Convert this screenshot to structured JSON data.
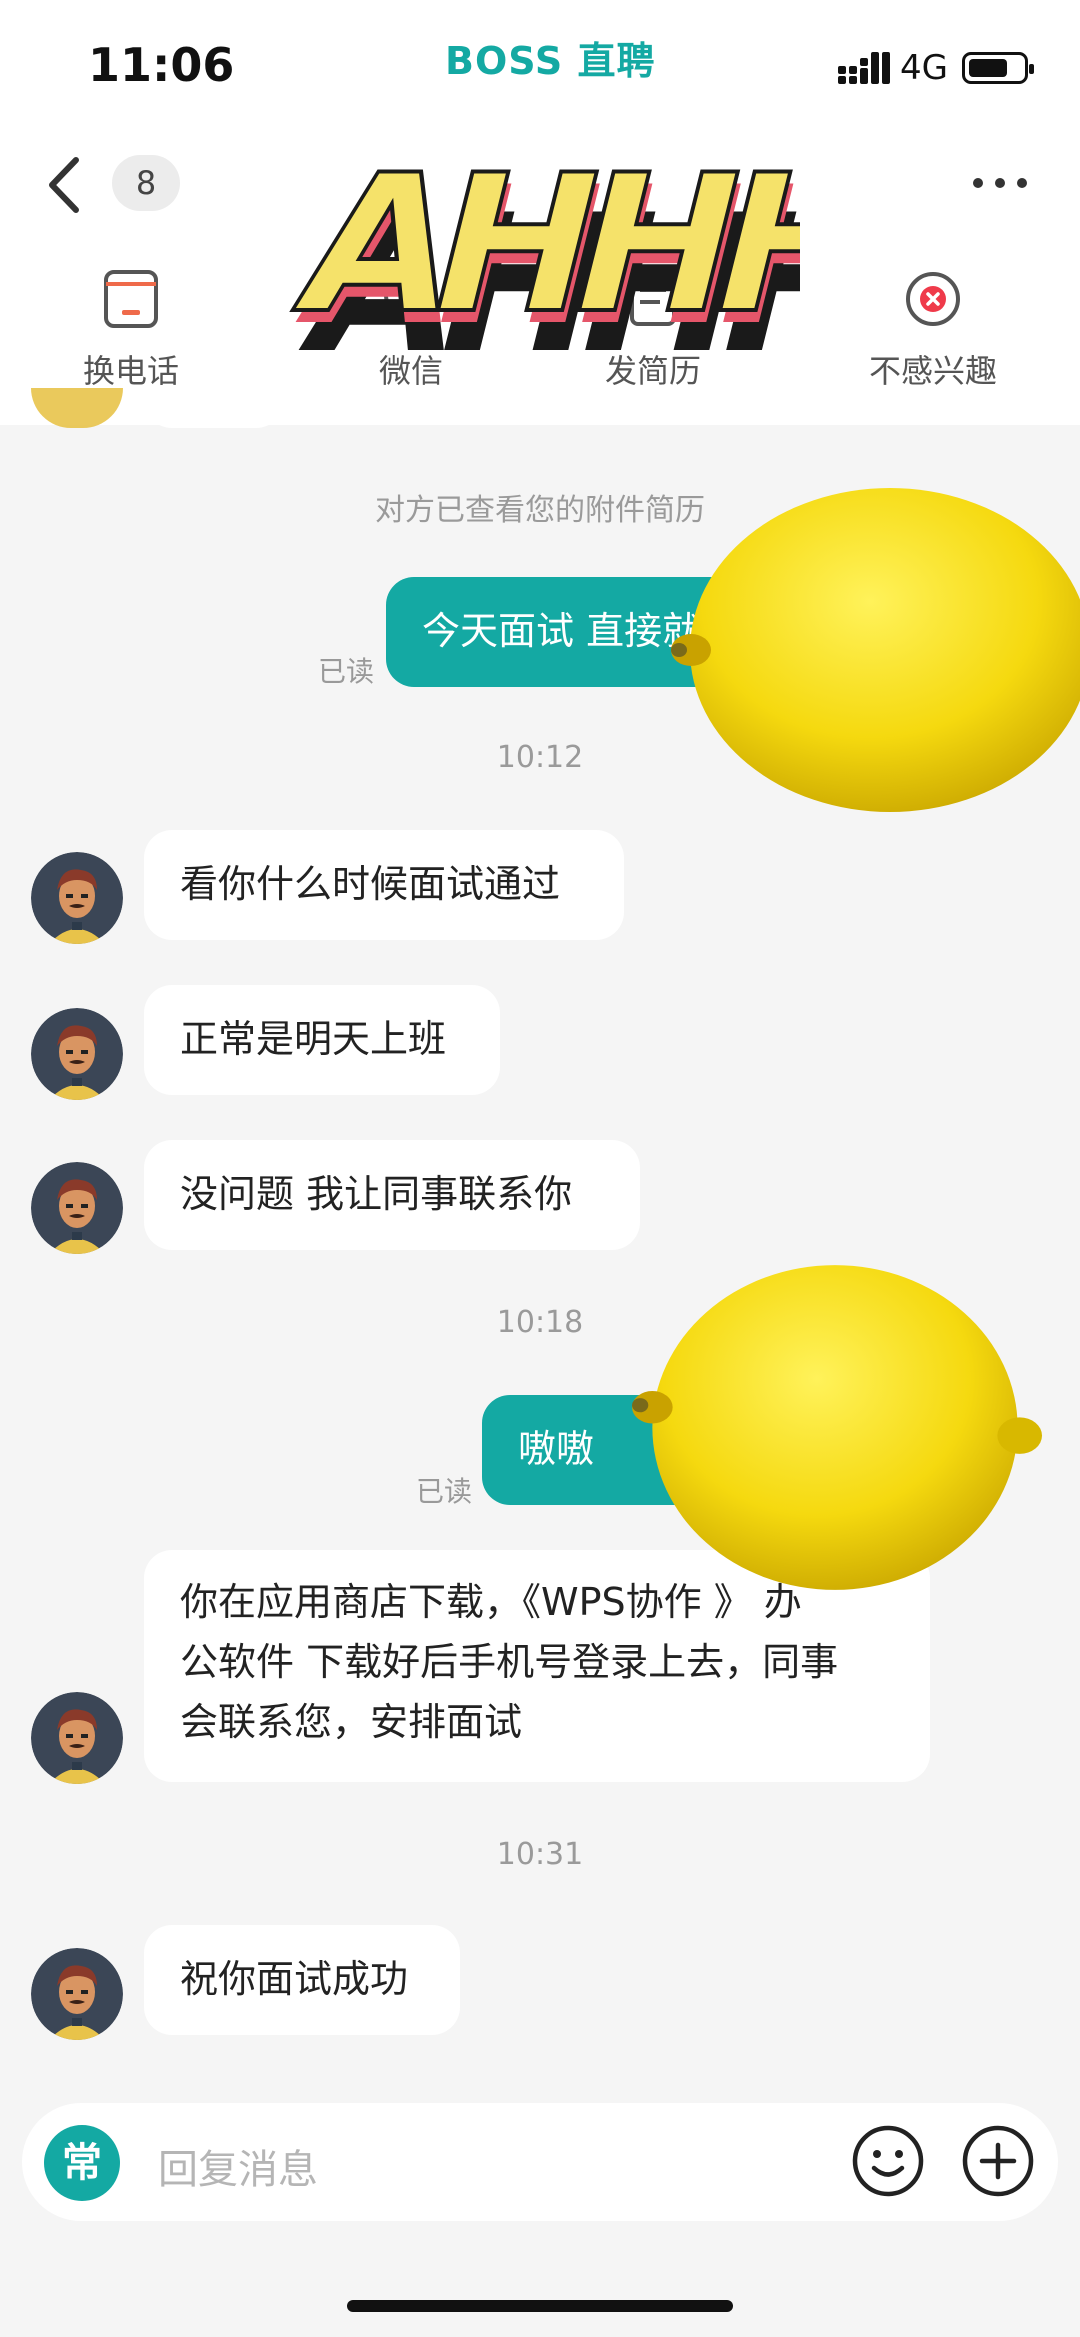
{
  "status_bar": {
    "time": "11:06",
    "network": "4G"
  },
  "app": {
    "logo_text": "BOSS 直聘"
  },
  "header": {
    "badge_count": "8"
  },
  "actions": [
    {
      "label": "换电话",
      "icon": "phone-swap-icon"
    },
    {
      "label": "微信",
      "icon": "wechat-icon"
    },
    {
      "label": "发简历",
      "icon": "resume-icon"
    },
    {
      "label": "不感兴趣",
      "icon": "not-interested-icon"
    }
  ],
  "sticker": {
    "text": "AHHHH!"
  },
  "messages": {
    "system_viewed": "对方已查看您的附件简历",
    "out1": {
      "text": "今天面试  直接就",
      "status": "已读"
    },
    "time1": "10:12",
    "in1": "看你什么时候面试通过",
    "in2": "正常是明天上班",
    "in3": "没问题 我让同事联系你",
    "time2": "10:18",
    "out2": {
      "text": "嗷嗷",
      "status": "已读"
    },
    "in4_lines": [
      "你在应用商店下载，《WPS协作 》 办",
      "公软件 下载好后手机号登录上去，同事",
      "会联系您，安排面试"
    ],
    "time3": "10:31",
    "in5": "祝你面试成功"
  },
  "input": {
    "quick_reply": "常",
    "placeholder": "回复消息"
  },
  "colors": {
    "accent": "#14a9a3",
    "lemon": "#f5d90f"
  }
}
